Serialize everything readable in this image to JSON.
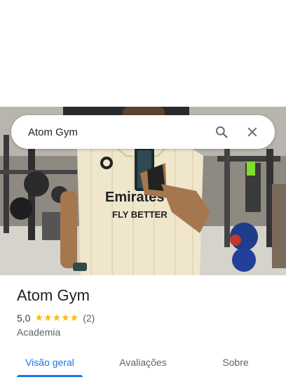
{
  "search": {
    "query": "Atom Gym"
  },
  "hero": {
    "photo_description_icon": "gym-photo-image",
    "shirt_text_line1": "Emirates",
    "shirt_text_line2": "FLY BETTER"
  },
  "place": {
    "name": "Atom Gym",
    "rating": "5,0",
    "stars": "★★★★★",
    "review_count": "(2)",
    "category": "Academia"
  },
  "tabs": [
    {
      "label": "Visão geral",
      "active": true
    },
    {
      "label": "Avaliações",
      "active": false
    },
    {
      "label": "Sobre",
      "active": false
    }
  ],
  "colors": {
    "accent": "#1a73e8",
    "star": "#fbbc04",
    "text_primary": "#202124",
    "text_secondary": "#5f6368"
  }
}
